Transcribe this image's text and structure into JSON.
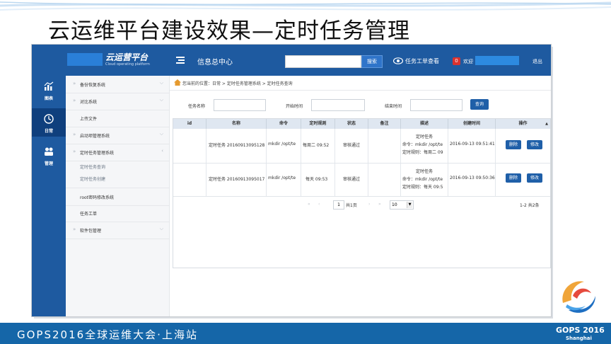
{
  "slide": {
    "title": "云运维平台建设效果—定时任务管理",
    "footer_left": "GOPS2016全球运维大会·上海站",
    "footer_right": "GOPS 2016",
    "footer_sub": "Shanghai"
  },
  "topbar": {
    "logo_text": "云运营平台",
    "logo_sub": "Cloud operating platform",
    "info_center": "信息总中心",
    "search_button": "搜索",
    "ticket_link": "任务工单查看",
    "badge_count": "0",
    "welcome": "欢迎",
    "logout": "退出"
  },
  "rail": {
    "items": [
      {
        "label": "图表",
        "icon": "chart-icon"
      },
      {
        "label": "日常",
        "icon": "clock-icon"
      },
      {
        "label": "管理",
        "icon": "users-icon"
      }
    ]
  },
  "sidebar": {
    "items": [
      {
        "label": "备份恢复系统"
      },
      {
        "label": "对比系统"
      },
      {
        "label": "上传文件"
      },
      {
        "label": "启动项管理系统"
      },
      {
        "label": "定时任务管理系统"
      },
      {
        "label": "root密码修改系统"
      },
      {
        "label": "任务工单"
      },
      {
        "label": "软件包管理"
      }
    ],
    "sub_items": [
      {
        "label": "定时任务查询"
      },
      {
        "label": "定时任务创建"
      }
    ]
  },
  "breadcrumb": "您当前的位置：日常 > 定时任务管理系统 > 定时任务查询",
  "filters": {
    "task_name_label": "任务名称",
    "start_label": "开始时间",
    "end_label": "结束时间",
    "query_button": "查询"
  },
  "table": {
    "headers": [
      "id",
      "名称",
      "命令",
      "定时规则",
      "状态",
      "备注",
      "描述",
      "创建时间",
      "操作"
    ],
    "rows": [
      {
        "id": "",
        "name": "定时任务 20160913095128",
        "command": "mkdir /opt/te",
        "rule": "每周二 09:52",
        "status": "审核通过",
        "note": "",
        "desc1": "定时任务",
        "desc2": "命令：mkdir /opt/te",
        "desc3": "定时规则：每周二 09",
        "created": "2016-09-13 09:51:41",
        "delete_label": "删除",
        "edit_label": "修改"
      },
      {
        "id": "",
        "name": "定时任务 20160913095017",
        "command": "mkdir /opt/te",
        "rule": "每天 09:53",
        "status": "审核通过",
        "note": "",
        "desc1": "定时任务",
        "desc2": "命令：mkdir /opt/te",
        "desc3": "定时规则：每天 09:5",
        "created": "2016-09-13 09:50:36",
        "delete_label": "删除",
        "edit_label": "修改"
      }
    ]
  },
  "pager": {
    "current_page": "1",
    "total_pages_text": "共1页",
    "page_size": "10",
    "range_text": "1-2 共2条"
  },
  "colors": {
    "brand": "#1e5aa0",
    "footer": "#1566a8",
    "button": "#1f5fa8"
  }
}
